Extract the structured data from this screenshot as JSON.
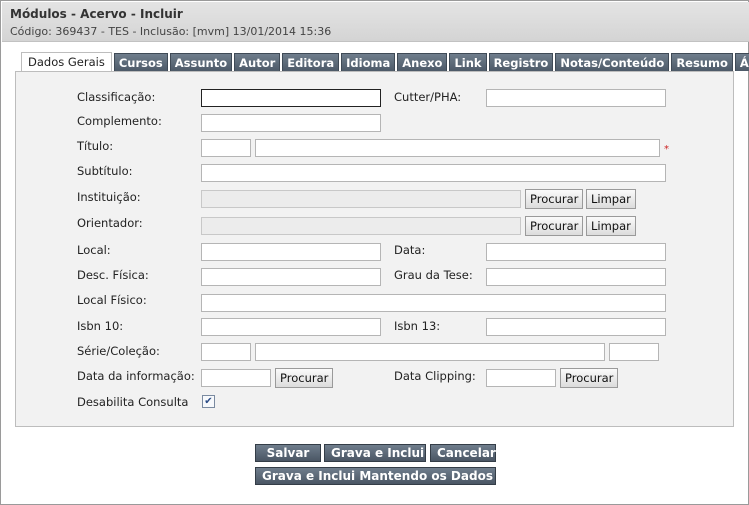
{
  "header": {
    "title": "Módulos - Acervo - Incluir",
    "subtitle": "Código: 369437 - TES - Inclusão: [mvm] 13/01/2014 15:36"
  },
  "tabs": [
    {
      "label": "Dados Gerais"
    },
    {
      "label": "Cursos"
    },
    {
      "label": "Assunto"
    },
    {
      "label": "Autor"
    },
    {
      "label": "Editora"
    },
    {
      "label": "Idioma"
    },
    {
      "label": "Anexo"
    },
    {
      "label": "Link"
    },
    {
      "label": "Registro"
    },
    {
      "label": "Notas/Conteúdo"
    },
    {
      "label": "Resumo"
    },
    {
      "label": "Área"
    }
  ],
  "form": {
    "classificacao": "Classificação:",
    "cutter": "Cutter/PHA:",
    "complemento": "Complemento:",
    "titulo": "Título:",
    "required_mark": "*",
    "subtitulo": "Subtítulo:",
    "instituicao": "Instituição:",
    "orientador": "Orientador:",
    "local": "Local:",
    "data": "Data:",
    "desc_fisica": "Desc. Física:",
    "grau_tese": "Grau da Tese:",
    "local_fisico": "Local Físico:",
    "isbn10": "Isbn 10:",
    "isbn13": "Isbn 13:",
    "serie": "Série/Coleção:",
    "data_informacao": "Data da informação:",
    "data_clipping": "Data Clipping:",
    "desabilita": "Desabilita Consulta",
    "desabilita_checked": true
  },
  "buttons": {
    "procurar": "Procurar",
    "limpar": "Limpar",
    "salvar": "Salvar",
    "grava_inclui": "Grava e Inclui",
    "cancelar": "Cancelar",
    "grava_mantendo": "Grava e Inclui Mantendo os Dados"
  }
}
